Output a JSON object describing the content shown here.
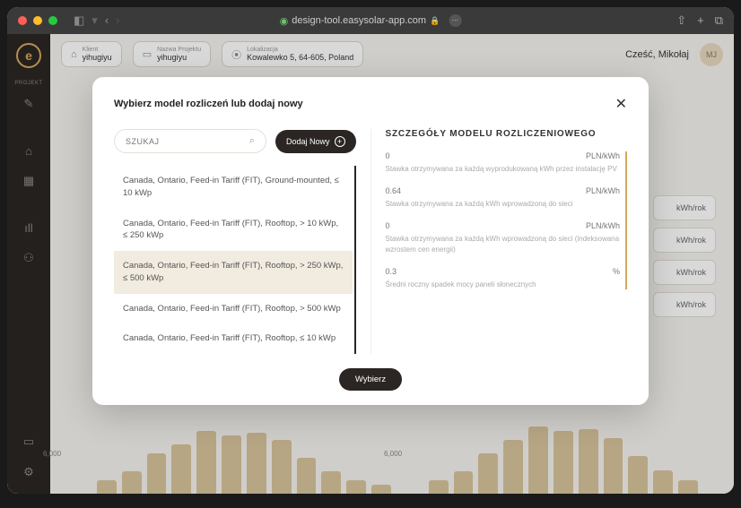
{
  "titlebar": {
    "url": "design-tool.easysolar-app.com"
  },
  "topbar": {
    "crumbs": [
      {
        "label": "Klient",
        "value": "yihugiyu"
      },
      {
        "label": "Nazwa Projektu",
        "value": "yihugiyu"
      },
      {
        "label": "Lokalizacja",
        "value": "Kowalewko 5, 64-605, Poland"
      }
    ],
    "greeting": "Cześć, Mikołaj",
    "avatar": "MJ"
  },
  "sidebar": {
    "sections": [
      "PROJEKT",
      ""
    ],
    "labels": [
      "",
      "",
      "",
      "",
      "",
      "",
      "",
      ""
    ]
  },
  "bg_chips": [
    "kWh/rok",
    "kWh/rok",
    "kWh/rok",
    "kWh/rok"
  ],
  "chart": {
    "ylabel": "6,000"
  },
  "modal": {
    "title": "Wybierz model rozliczeń lub dodaj nowy",
    "search_placeholder": "SZUKAJ",
    "add_label": "Dodaj Nowy",
    "items": [
      "Canada, Ontario, Feed-in Tariff (FIT), Ground-mounted, ≤ 10 kWp",
      "Canada, Ontario, Feed-in Tariff (FIT), Rooftop, > 10 kWp, ≤ 250 kWp",
      "Canada, Ontario, Feed-in Tariff (FIT), Rooftop, > 250 kWp, ≤ 500 kWp",
      "Canada, Ontario, Feed-in Tariff (FIT), Rooftop, > 500 kWp",
      "Canada, Ontario, Feed-in Tariff (FIT), Rooftop, ≤ 10 kWp"
    ],
    "details_title": "SZCZEGÓŁY MODELU ROZLICZENIOWEGO",
    "details": [
      {
        "val": "0",
        "unit": "PLN/kWh",
        "desc": "Stawka otrzymywana za każdą wyprodukowaną kWh przez instalację PV"
      },
      {
        "val": "0.64",
        "unit": "PLN/kWh",
        "desc": "Stawka otrzymywana za każdą kWh wprowadzoną do sieci"
      },
      {
        "val": "0",
        "unit": "PLN/kWh",
        "desc": "Stawka otrzymywana za każdą kWh wprowadzoną do sieci (indeksowana wzrostem cen energii)"
      },
      {
        "val": "0.3",
        "unit": "%",
        "desc": "Średni roczny spadek mocy paneli słonecznych"
      }
    ],
    "select_label": "Wybierz"
  }
}
